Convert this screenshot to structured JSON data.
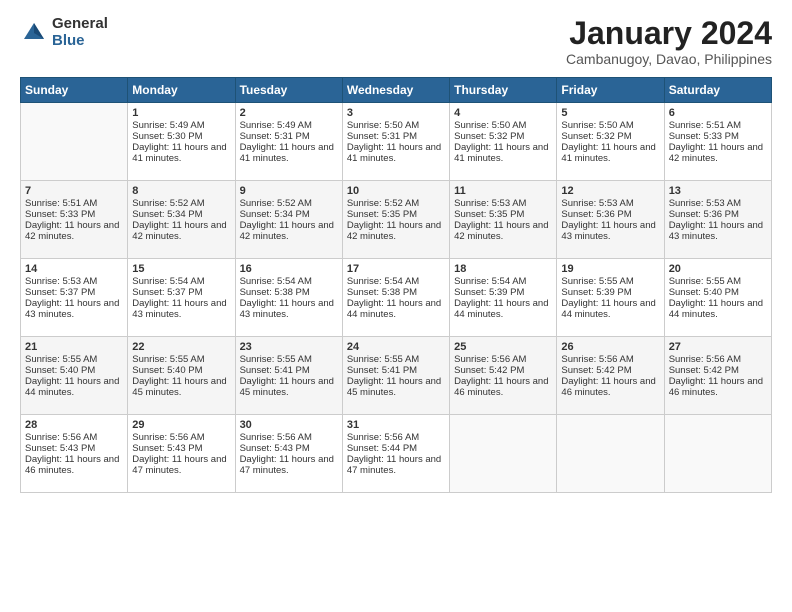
{
  "header": {
    "logo_general": "General",
    "logo_blue": "Blue",
    "month_title": "January 2024",
    "location": "Cambanugoy, Davao, Philippines"
  },
  "days_of_week": [
    "Sunday",
    "Monday",
    "Tuesday",
    "Wednesday",
    "Thursday",
    "Friday",
    "Saturday"
  ],
  "weeks": [
    [
      {
        "day": "",
        "sunrise": "",
        "sunset": "",
        "daylight": ""
      },
      {
        "day": "1",
        "sunrise": "Sunrise: 5:49 AM",
        "sunset": "Sunset: 5:30 PM",
        "daylight": "Daylight: 11 hours and 41 minutes."
      },
      {
        "day": "2",
        "sunrise": "Sunrise: 5:49 AM",
        "sunset": "Sunset: 5:31 PM",
        "daylight": "Daylight: 11 hours and 41 minutes."
      },
      {
        "day": "3",
        "sunrise": "Sunrise: 5:50 AM",
        "sunset": "Sunset: 5:31 PM",
        "daylight": "Daylight: 11 hours and 41 minutes."
      },
      {
        "day": "4",
        "sunrise": "Sunrise: 5:50 AM",
        "sunset": "Sunset: 5:32 PM",
        "daylight": "Daylight: 11 hours and 41 minutes."
      },
      {
        "day": "5",
        "sunrise": "Sunrise: 5:50 AM",
        "sunset": "Sunset: 5:32 PM",
        "daylight": "Daylight: 11 hours and 41 minutes."
      },
      {
        "day": "6",
        "sunrise": "Sunrise: 5:51 AM",
        "sunset": "Sunset: 5:33 PM",
        "daylight": "Daylight: 11 hours and 42 minutes."
      }
    ],
    [
      {
        "day": "7",
        "sunrise": "Sunrise: 5:51 AM",
        "sunset": "Sunset: 5:33 PM",
        "daylight": "Daylight: 11 hours and 42 minutes."
      },
      {
        "day": "8",
        "sunrise": "Sunrise: 5:52 AM",
        "sunset": "Sunset: 5:34 PM",
        "daylight": "Daylight: 11 hours and 42 minutes."
      },
      {
        "day": "9",
        "sunrise": "Sunrise: 5:52 AM",
        "sunset": "Sunset: 5:34 PM",
        "daylight": "Daylight: 11 hours and 42 minutes."
      },
      {
        "day": "10",
        "sunrise": "Sunrise: 5:52 AM",
        "sunset": "Sunset: 5:35 PM",
        "daylight": "Daylight: 11 hours and 42 minutes."
      },
      {
        "day": "11",
        "sunrise": "Sunrise: 5:53 AM",
        "sunset": "Sunset: 5:35 PM",
        "daylight": "Daylight: 11 hours and 42 minutes."
      },
      {
        "day": "12",
        "sunrise": "Sunrise: 5:53 AM",
        "sunset": "Sunset: 5:36 PM",
        "daylight": "Daylight: 11 hours and 43 minutes."
      },
      {
        "day": "13",
        "sunrise": "Sunrise: 5:53 AM",
        "sunset": "Sunset: 5:36 PM",
        "daylight": "Daylight: 11 hours and 43 minutes."
      }
    ],
    [
      {
        "day": "14",
        "sunrise": "Sunrise: 5:53 AM",
        "sunset": "Sunset: 5:37 PM",
        "daylight": "Daylight: 11 hours and 43 minutes."
      },
      {
        "day": "15",
        "sunrise": "Sunrise: 5:54 AM",
        "sunset": "Sunset: 5:37 PM",
        "daylight": "Daylight: 11 hours and 43 minutes."
      },
      {
        "day": "16",
        "sunrise": "Sunrise: 5:54 AM",
        "sunset": "Sunset: 5:38 PM",
        "daylight": "Daylight: 11 hours and 43 minutes."
      },
      {
        "day": "17",
        "sunrise": "Sunrise: 5:54 AM",
        "sunset": "Sunset: 5:38 PM",
        "daylight": "Daylight: 11 hours and 44 minutes."
      },
      {
        "day": "18",
        "sunrise": "Sunrise: 5:54 AM",
        "sunset": "Sunset: 5:39 PM",
        "daylight": "Daylight: 11 hours and 44 minutes."
      },
      {
        "day": "19",
        "sunrise": "Sunrise: 5:55 AM",
        "sunset": "Sunset: 5:39 PM",
        "daylight": "Daylight: 11 hours and 44 minutes."
      },
      {
        "day": "20",
        "sunrise": "Sunrise: 5:55 AM",
        "sunset": "Sunset: 5:40 PM",
        "daylight": "Daylight: 11 hours and 44 minutes."
      }
    ],
    [
      {
        "day": "21",
        "sunrise": "Sunrise: 5:55 AM",
        "sunset": "Sunset: 5:40 PM",
        "daylight": "Daylight: 11 hours and 44 minutes."
      },
      {
        "day": "22",
        "sunrise": "Sunrise: 5:55 AM",
        "sunset": "Sunset: 5:40 PM",
        "daylight": "Daylight: 11 hours and 45 minutes."
      },
      {
        "day": "23",
        "sunrise": "Sunrise: 5:55 AM",
        "sunset": "Sunset: 5:41 PM",
        "daylight": "Daylight: 11 hours and 45 minutes."
      },
      {
        "day": "24",
        "sunrise": "Sunrise: 5:55 AM",
        "sunset": "Sunset: 5:41 PM",
        "daylight": "Daylight: 11 hours and 45 minutes."
      },
      {
        "day": "25",
        "sunrise": "Sunrise: 5:56 AM",
        "sunset": "Sunset: 5:42 PM",
        "daylight": "Daylight: 11 hours and 46 minutes."
      },
      {
        "day": "26",
        "sunrise": "Sunrise: 5:56 AM",
        "sunset": "Sunset: 5:42 PM",
        "daylight": "Daylight: 11 hours and 46 minutes."
      },
      {
        "day": "27",
        "sunrise": "Sunrise: 5:56 AM",
        "sunset": "Sunset: 5:42 PM",
        "daylight": "Daylight: 11 hours and 46 minutes."
      }
    ],
    [
      {
        "day": "28",
        "sunrise": "Sunrise: 5:56 AM",
        "sunset": "Sunset: 5:43 PM",
        "daylight": "Daylight: 11 hours and 46 minutes."
      },
      {
        "day": "29",
        "sunrise": "Sunrise: 5:56 AM",
        "sunset": "Sunset: 5:43 PM",
        "daylight": "Daylight: 11 hours and 47 minutes."
      },
      {
        "day": "30",
        "sunrise": "Sunrise: 5:56 AM",
        "sunset": "Sunset: 5:43 PM",
        "daylight": "Daylight: 11 hours and 47 minutes."
      },
      {
        "day": "31",
        "sunrise": "Sunrise: 5:56 AM",
        "sunset": "Sunset: 5:44 PM",
        "daylight": "Daylight: 11 hours and 47 minutes."
      },
      {
        "day": "",
        "sunrise": "",
        "sunset": "",
        "daylight": ""
      },
      {
        "day": "",
        "sunrise": "",
        "sunset": "",
        "daylight": ""
      },
      {
        "day": "",
        "sunrise": "",
        "sunset": "",
        "daylight": ""
      }
    ]
  ]
}
